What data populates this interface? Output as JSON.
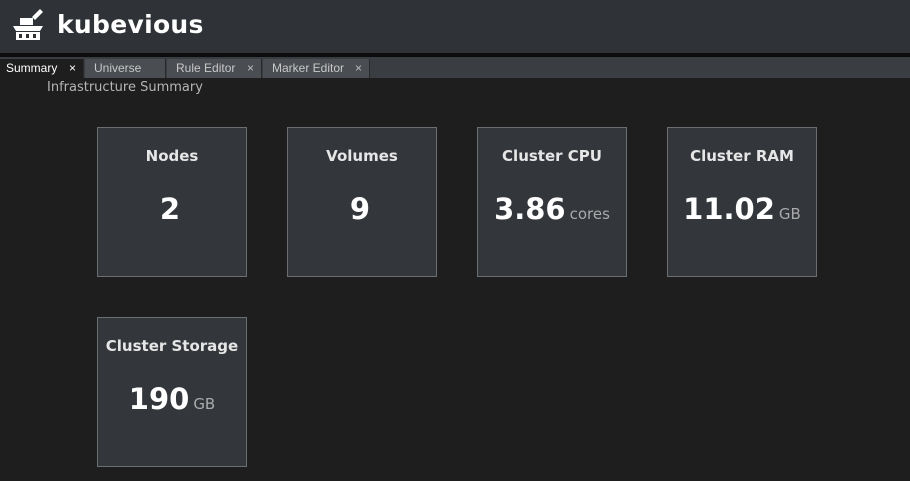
{
  "app": {
    "name": "kubevious",
    "logo_icon": "kubevious-ship-icon"
  },
  "tabs": [
    {
      "label": "Summary",
      "active": true,
      "closable": true
    },
    {
      "label": "Universe",
      "active": false,
      "closable": false
    },
    {
      "label": "Rule Editor",
      "active": false,
      "closable": true
    },
    {
      "label": "Marker Editor",
      "active": false,
      "closable": true
    }
  ],
  "close_glyph": "×",
  "summary": {
    "title": "Infrastructure Summary",
    "cards": [
      {
        "title": "Nodes",
        "value": "2",
        "unit": ""
      },
      {
        "title": "Volumes",
        "value": "9",
        "unit": ""
      },
      {
        "title": "Cluster CPU",
        "value": "3.86",
        "unit": "cores"
      },
      {
        "title": "Cluster RAM",
        "value": "11.02",
        "unit": "GB"
      },
      {
        "title": "Cluster Storage",
        "value": "190",
        "unit": "GB"
      }
    ]
  },
  "colors": {
    "header_bg": "#2f3237",
    "body_bg": "#1e1e1e",
    "card_bg": "#33363b"
  }
}
